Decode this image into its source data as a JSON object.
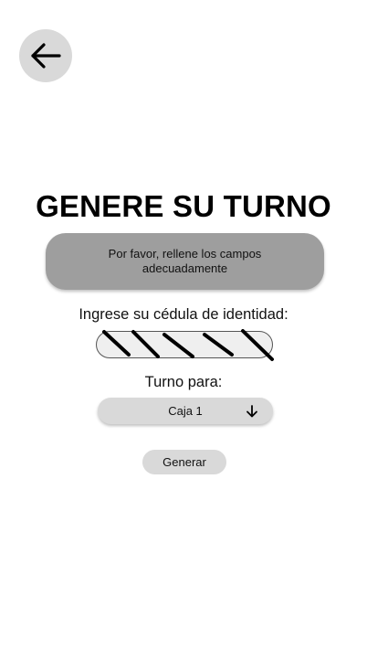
{
  "header": {
    "back_icon": "arrow-left-icon"
  },
  "page": {
    "title": "GENERE SU TURNO"
  },
  "alert": {
    "message": "Por favor, rellene los campos adecuadamente"
  },
  "form": {
    "id_label": "Ingrese su cédula de identidad:",
    "id_value": "",
    "turn_label": "Turno para:",
    "turn_selected": "Caja 1",
    "dropdown_icon": "arrow-down-icon",
    "submit_label": "Generar"
  },
  "colors": {
    "background": "#ffffff",
    "alert_bg": "#9e9e9e",
    "control_bg": "#d9d9d9",
    "scribble": "#000000"
  }
}
